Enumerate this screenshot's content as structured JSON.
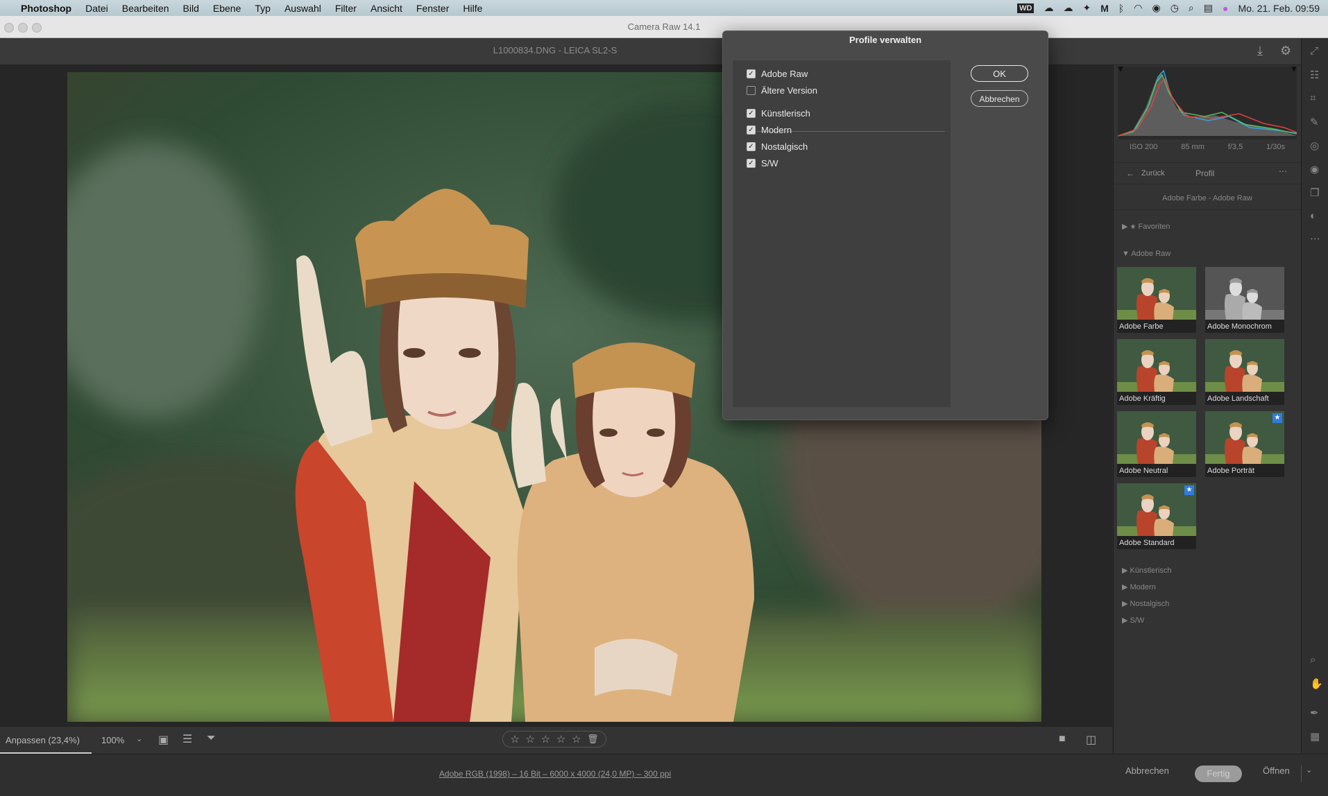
{
  "menubar": {
    "app": "Photoshop",
    "items": [
      "Datei",
      "Bearbeiten",
      "Bild",
      "Ebene",
      "Typ",
      "Auswahl",
      "Filter",
      "Ansicht",
      "Fenster",
      "Hilfe"
    ],
    "datetime": "Mo. 21. Feb. 09:59"
  },
  "window": {
    "title": "Camera Raw 14.1"
  },
  "toolbar": {
    "filename": "L1000834.DNG - LEICA SL2-S"
  },
  "dialog": {
    "title": "Profile verwalten",
    "ok": "OK",
    "cancel": "Abbrechen",
    "items": [
      {
        "label": "Adobe Raw",
        "checked": true
      },
      {
        "label": "Ältere Version",
        "checked": false
      },
      {
        "label": "Künstlerisch",
        "checked": true
      },
      {
        "label": "Modern",
        "checked": true
      },
      {
        "label": "Nostalgisch",
        "checked": true
      },
      {
        "label": "S/W",
        "checked": true
      }
    ]
  },
  "panel": {
    "exif": [
      "ISO 200",
      "85 mm",
      "f/3,5",
      "1/30s"
    ],
    "back": "Zurück",
    "header": "Profil",
    "current": "Adobe Farbe - Adobe Raw",
    "favorites": "Favoriten",
    "group": "Adobe Raw",
    "profiles": [
      {
        "name": "Adobe Farbe",
        "favorite": false,
        "mono": false
      },
      {
        "name": "Adobe Monochrom",
        "favorite": false,
        "mono": true
      },
      {
        "name": "Adobe Kräftig",
        "favorite": false,
        "mono": false
      },
      {
        "name": "Adobe Landschaft",
        "favorite": false,
        "mono": false
      },
      {
        "name": "Adobe Neutral",
        "favorite": false,
        "mono": false
      },
      {
        "name": "Adobe Porträt",
        "favorite": true,
        "mono": false
      },
      {
        "name": "Adobe Standard",
        "favorite": true,
        "mono": false
      }
    ],
    "subgroups": [
      "Künstlerisch",
      "Modern",
      "Nostalgisch",
      "S/W"
    ]
  },
  "bottombar": {
    "fit": "Anpassen (23,4%)",
    "zoom": "100%"
  },
  "footer": {
    "fileinfo": "Adobe RGB (1998) – 16 Bit – 6000 x 4000 (24,0 MP) – 300 ppi",
    "cancel": "Abbrechen",
    "done": "Fertig",
    "open": "Öffnen"
  }
}
